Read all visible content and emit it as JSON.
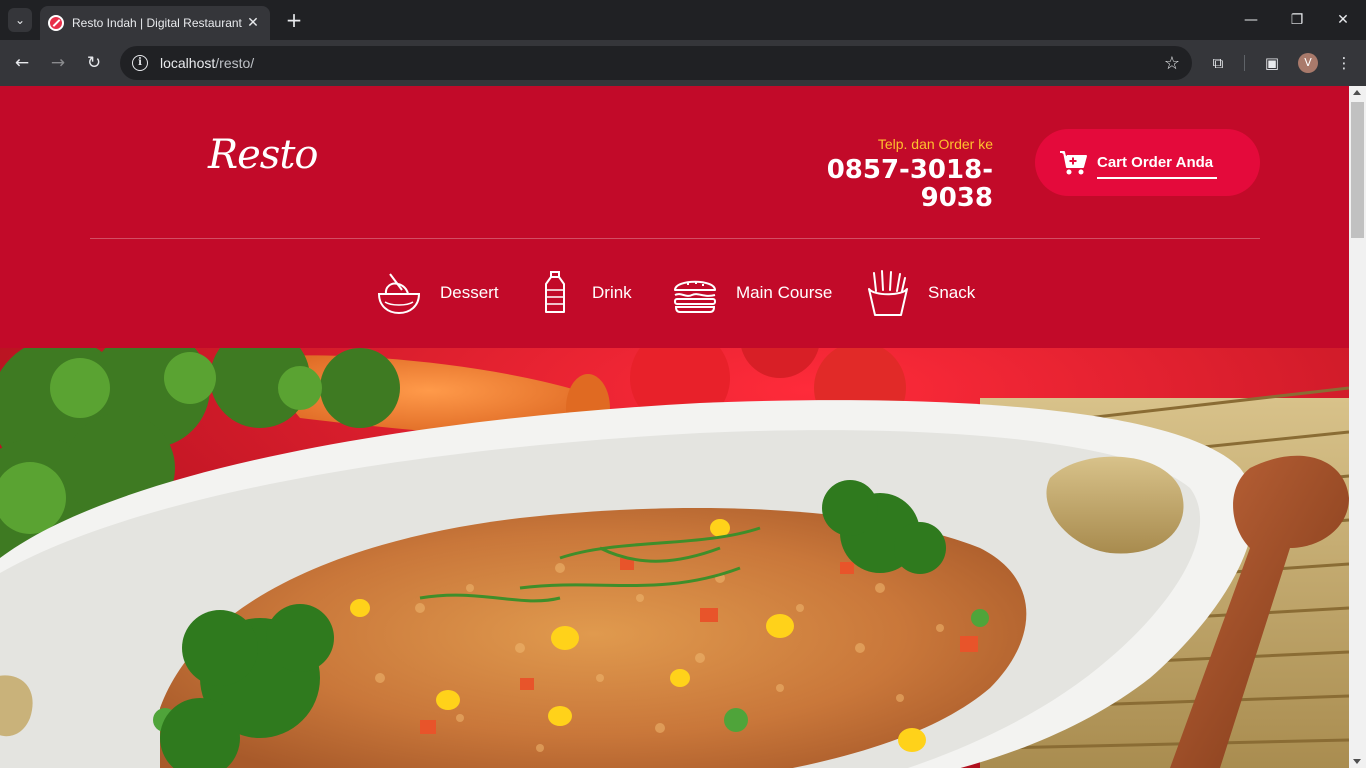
{
  "browser": {
    "tab_title": "Resto Indah | Digital Restaurant",
    "url_host": "localhost",
    "url_path": "/resto/",
    "profile_initial": "V"
  },
  "site": {
    "logo": "Resto",
    "contact_label": "Telp. dan Order ke",
    "contact_phone": "0857-3018-9038",
    "cart_label": "Cart Order Anda",
    "categories": [
      {
        "label": "Dessert",
        "icon": "dessert-bowl-icon"
      },
      {
        "label": "Drink",
        "icon": "bottle-icon"
      },
      {
        "label": "Main Course",
        "icon": "burger-icon"
      },
      {
        "label": "Snack",
        "icon": "fries-icon"
      }
    ]
  },
  "colors": {
    "header_red": "#c20a29",
    "cart_button": "#e40a3b",
    "accent_yellow": "#ffc22d"
  }
}
